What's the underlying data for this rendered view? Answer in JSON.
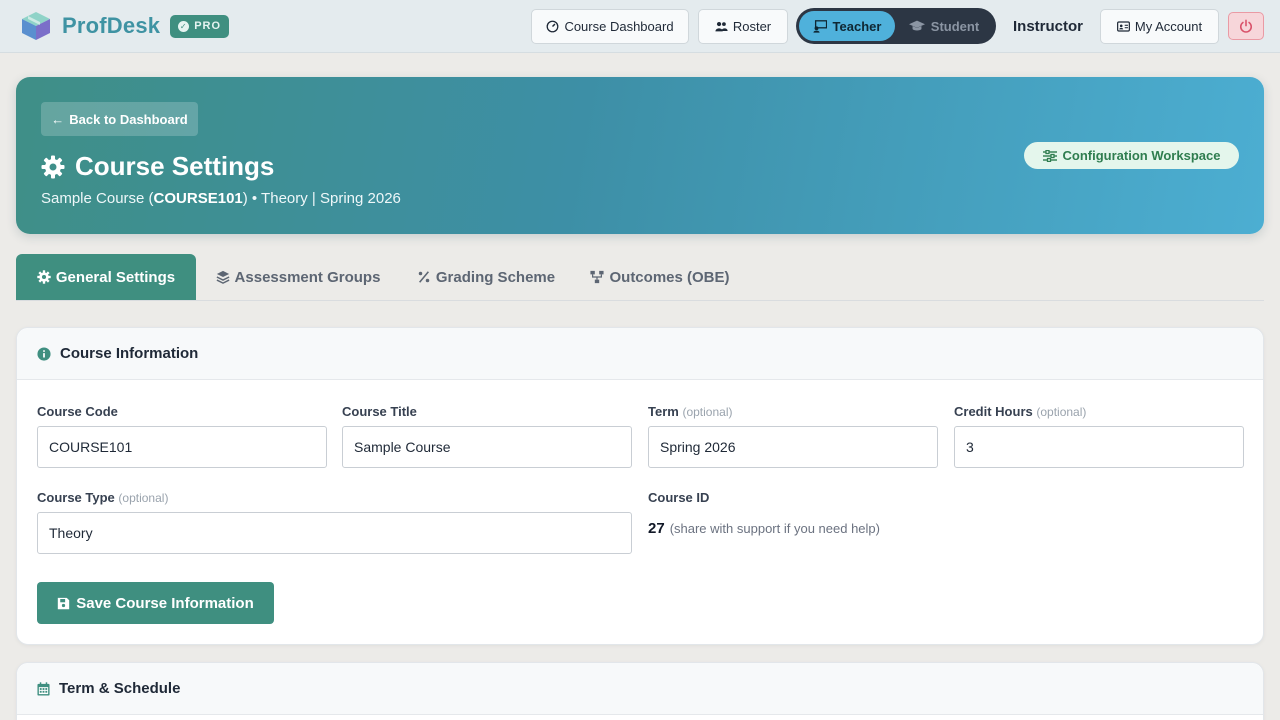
{
  "brand": {
    "name": "ProfDesk",
    "badge": "PRO"
  },
  "nav": {
    "course_dashboard": "Course Dashboard",
    "roster": "Roster",
    "mode_active": "Teacher",
    "mode_inactive": "Student",
    "role": "Instructor",
    "account": "My Account"
  },
  "hero": {
    "back": "Back to Dashboard",
    "title": "Course Settings",
    "course_name": "Sample Course (",
    "course_code": "COURSE101",
    "course_tail": ") • Theory | Spring 2026",
    "workspace_pill": "Configuration Workspace"
  },
  "tabs": [
    {
      "label": "General Settings",
      "icon": "gear-icon"
    },
    {
      "label": "Assessment Groups",
      "icon": "layers-icon"
    },
    {
      "label": "Grading Scheme",
      "icon": "percent-icon"
    },
    {
      "label": "Outcomes (OBE)",
      "icon": "sitemap-icon"
    }
  ],
  "course_info": {
    "heading": "Course Information",
    "code_label": "Course Code",
    "code_value": "COURSE101",
    "title_label": "Course Title",
    "title_value": "Sample Course",
    "term_label": "Term",
    "term_value": "Spring 2026",
    "credit_label": "Credit Hours",
    "credit_value": "3",
    "type_label": "Course Type",
    "type_value": "Theory",
    "optional": "(optional)",
    "id_label": "Course ID",
    "id_value": "27",
    "id_hint": "(share with support if you need help)",
    "save": "Save Course Information"
  },
  "schedule": {
    "heading": "Term & Schedule"
  },
  "colors": {
    "primary": "#3f8f80",
    "accent": "#4fb1db",
    "brand": "#3f93a3"
  }
}
